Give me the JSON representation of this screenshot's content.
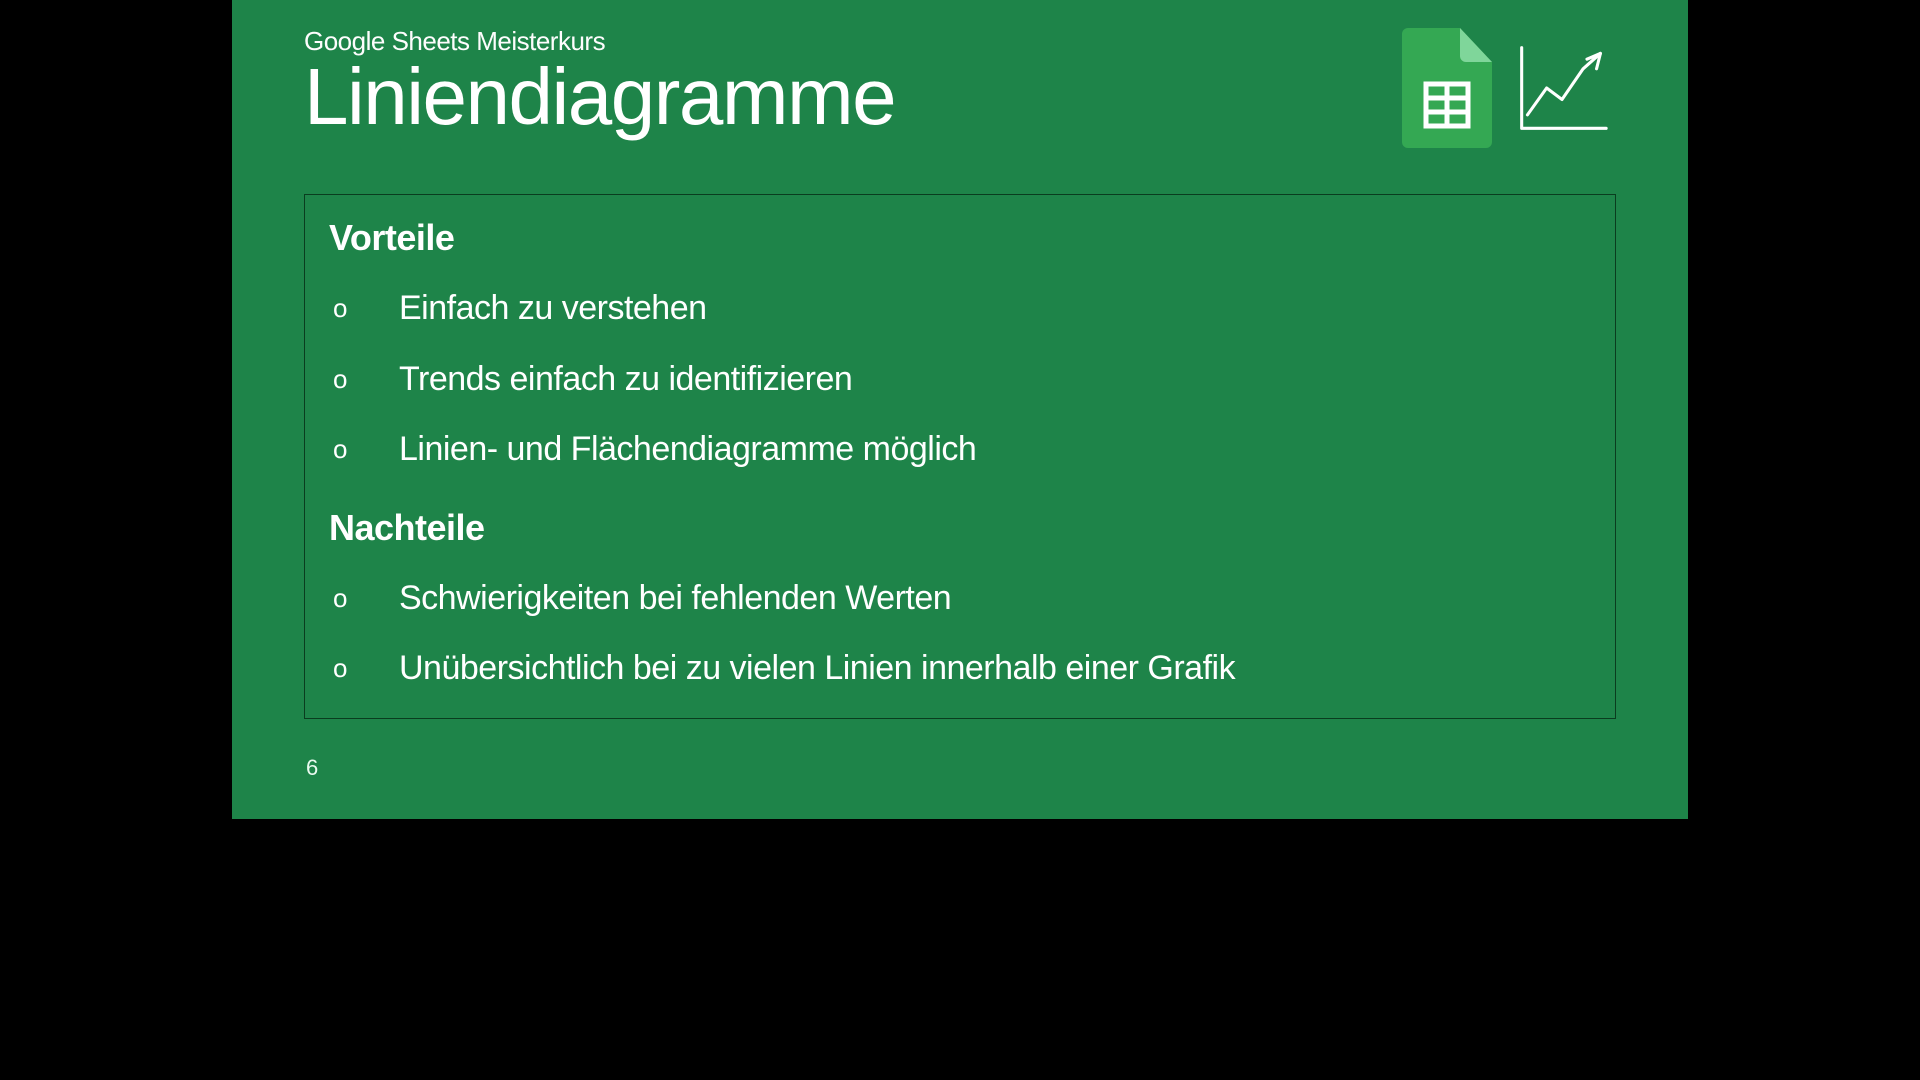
{
  "slide": {
    "eyebrow": "Google Sheets Meisterkurs",
    "title": "Liniendiagramme",
    "page_number": "6",
    "sections": [
      {
        "heading": "Vorteile",
        "items": [
          "Einfach zu verstehen",
          "Trends einfach zu identifizieren",
          "Linien- und Flächendiagramme möglich"
        ]
      },
      {
        "heading": "Nachteile",
        "items": [
          "Schwierigkeiten bei fehlenden Werten",
          "Unübersichtlich bei zu vielen Linien innerhalb einer Grafik"
        ]
      }
    ],
    "bullet_glyph": "o"
  },
  "colors": {
    "background": "#1e8449",
    "box_border": "#0a3d1f",
    "text": "#ffffff",
    "sheets_green": "#34a853",
    "sheets_fold": "#7fd69a"
  }
}
